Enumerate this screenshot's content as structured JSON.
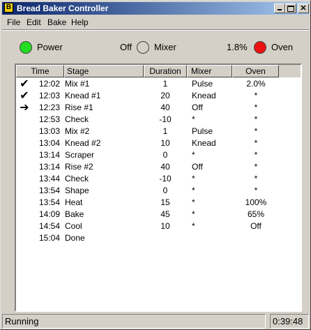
{
  "window": {
    "icon_letter": "B",
    "title": "Bread Baker Controller",
    "minimize_icon": "minimize-icon",
    "maximize_icon": "maximize-icon",
    "close_icon": "close-icon"
  },
  "menu": [
    {
      "label": "File"
    },
    {
      "label": "Edit"
    },
    {
      "label": "Bake"
    },
    {
      "label": "Help"
    }
  ],
  "indicators": {
    "power": {
      "label": "Power",
      "color": "#22dd22"
    },
    "mixer": {
      "label": "Mixer",
      "state": "Off",
      "color": "#d4d0c8"
    },
    "oven": {
      "label": "Oven",
      "level": "1.8%",
      "color": "#ee1111"
    }
  },
  "table": {
    "columns": [
      "Time",
      "Stage",
      "Duration",
      "Mixer",
      "Oven"
    ],
    "rows": [
      {
        "mark": "check",
        "mark_glyph": "✔",
        "time": "12:02",
        "stage": "Mix #1",
        "duration": "1",
        "mixer": "Pulse",
        "oven": "2.0%"
      },
      {
        "mark": "check",
        "mark_glyph": "✔",
        "time": "12:03",
        "stage": "Knead #1",
        "duration": "20",
        "mixer": "Knead",
        "oven": "*"
      },
      {
        "mark": "arrow",
        "mark_glyph": "➔",
        "time": "12:23",
        "stage": "Rise #1",
        "duration": "40",
        "mixer": "Off",
        "oven": "*"
      },
      {
        "mark": "",
        "mark_glyph": "",
        "time": "12:53",
        "stage": "Check",
        "duration": "-10",
        "mixer": "*",
        "oven": "*"
      },
      {
        "mark": "",
        "mark_glyph": "",
        "time": "13:03",
        "stage": "Mix #2",
        "duration": "1",
        "mixer": "Pulse",
        "oven": "*"
      },
      {
        "mark": "",
        "mark_glyph": "",
        "time": "13:04",
        "stage": "Knead #2",
        "duration": "10",
        "mixer": "Knead",
        "oven": "*"
      },
      {
        "mark": "",
        "mark_glyph": "",
        "time": "13:14",
        "stage": "Scraper",
        "duration": "0",
        "mixer": "*",
        "oven": "*"
      },
      {
        "mark": "",
        "mark_glyph": "",
        "time": "13:14",
        "stage": "Rise #2",
        "duration": "40",
        "mixer": "Off",
        "oven": "*"
      },
      {
        "mark": "",
        "mark_glyph": "",
        "time": "13:44",
        "stage": "Check",
        "duration": "-10",
        "mixer": "*",
        "oven": "*"
      },
      {
        "mark": "",
        "mark_glyph": "",
        "time": "13:54",
        "stage": "Shape",
        "duration": "0",
        "mixer": "*",
        "oven": "*"
      },
      {
        "mark": "",
        "mark_glyph": "",
        "time": "13:54",
        "stage": "Heat",
        "duration": "15",
        "mixer": "*",
        "oven": "100%"
      },
      {
        "mark": "",
        "mark_glyph": "",
        "time": "14:09",
        "stage": "Bake",
        "duration": "45",
        "mixer": "*",
        "oven": "65%"
      },
      {
        "mark": "",
        "mark_glyph": "",
        "time": "14:54",
        "stage": "Cool",
        "duration": "10",
        "mixer": "*",
        "oven": "Off"
      },
      {
        "mark": "",
        "mark_glyph": "",
        "time": "15:04",
        "stage": "Done",
        "duration": "",
        "mixer": "",
        "oven": ""
      }
    ]
  },
  "status": {
    "text": "Running",
    "elapsed": "0:39:48"
  }
}
